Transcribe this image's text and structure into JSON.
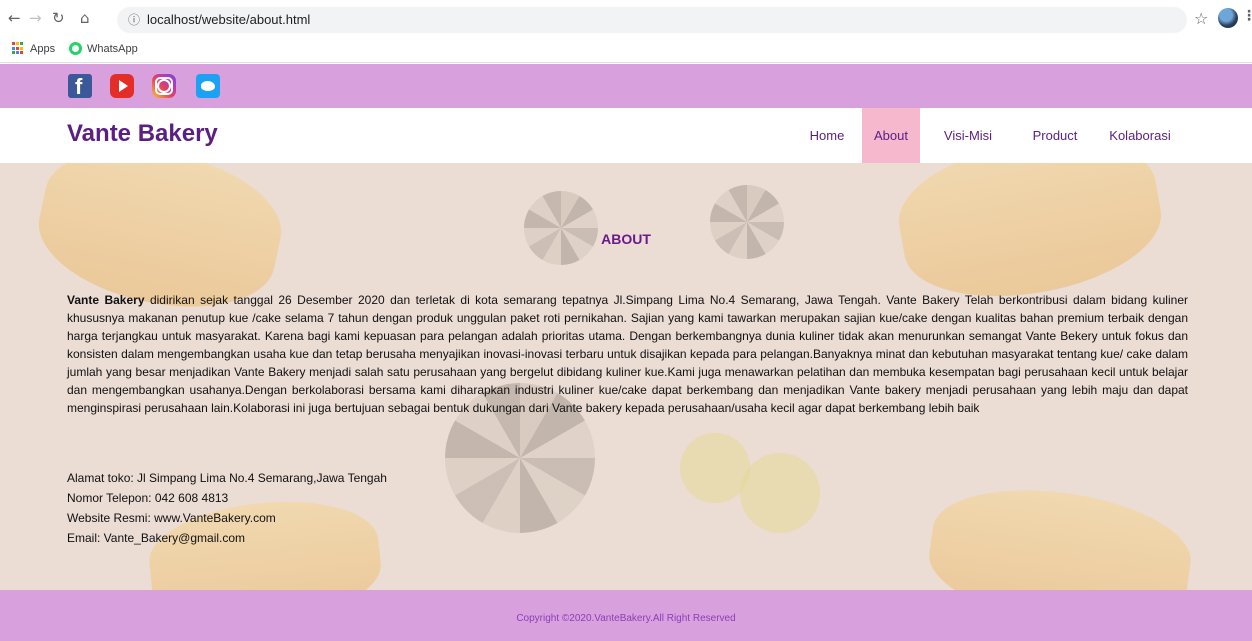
{
  "browser": {
    "url": "localhost/website/about.html",
    "bookmarks": [
      "Apps",
      "WhatsApp"
    ]
  },
  "social": [
    "facebook",
    "youtube",
    "instagram",
    "twitter"
  ],
  "site": {
    "brand": "Vante Bakery",
    "nav": [
      "Home",
      "About",
      "Visi-Misi",
      "Product",
      "Kolaborasi"
    ],
    "active_nav": "About"
  },
  "about": {
    "title": "ABOUT",
    "brand_bold": "Vante Bakery",
    "body": " didirikan sejak tanggal 26 Desember 2020 dan terletak di kota semarang tepatnya Jl.Simpang Lima No.4 Semarang, Jawa Tengah. Vante Bakery Telah berkontribusi dalam bidang kuliner khususnya makanan penutup kue /cake selama 7 tahun dengan produk unggulan paket roti pernikahan. Sajian yang kami tawarkan merupakan sajian kue/cake dengan kualitas bahan premium terbaik dengan harga terjangkau untuk masyarakat. Karena bagi kami kepuasan para pelangan adalah prioritas utama. Dengan berkembangnya dunia kuliner tidak akan menurunkan semangat Vante Bekery untuk fokus dan konsisten dalam mengembangkan usaha kue dan tetap berusaha menyajikan inovasi-inovasi terbaru untuk disajikan kepada para pelangan.Banyaknya minat dan kebutuhan masyarakat tentang kue/ cake dalam jumlah yang besar menjadikan Vante Bakery menjadi salah satu perusahaan yang bergelut dibidang kuliner kue.Kami juga menawarkan pelatihan dan membuka kesempatan bagi perusahaan kecil untuk belajar dan mengembangkan usahanya.Dengan berkolaborasi bersama kami diharapkan industri kuliner kue/cake dapat berkembang dan menjadikan Vante bakery menjadi perusahaan yang lebih maju dan dapat menginspirasi perusahaan lain.Kolaborasi ini juga bertujuan sebagai bentuk dukungan dari Vante bakery kepada perusahaan/usaha kecil agar dapat berkembang lebih baik"
  },
  "contact": {
    "address": "Alamat toko: Jl Simpang Lima No.4 Semarang,Jawa Tengah",
    "phone": "Nomor Telepon: 042 608 4813",
    "website": "Website Resmi: www.VanteBakery.com",
    "email": "Email: Vante_Bakery@gmail.com"
  },
  "footer": {
    "copyright": "Copyright ©2020.VanteBakery.All Right Reserved"
  },
  "colors": {
    "purple_bar": "#d9a0de",
    "brand": "#5b1f82",
    "active_nav_bg": "#f5b8cd",
    "content_bg": "#ebdcd4"
  }
}
